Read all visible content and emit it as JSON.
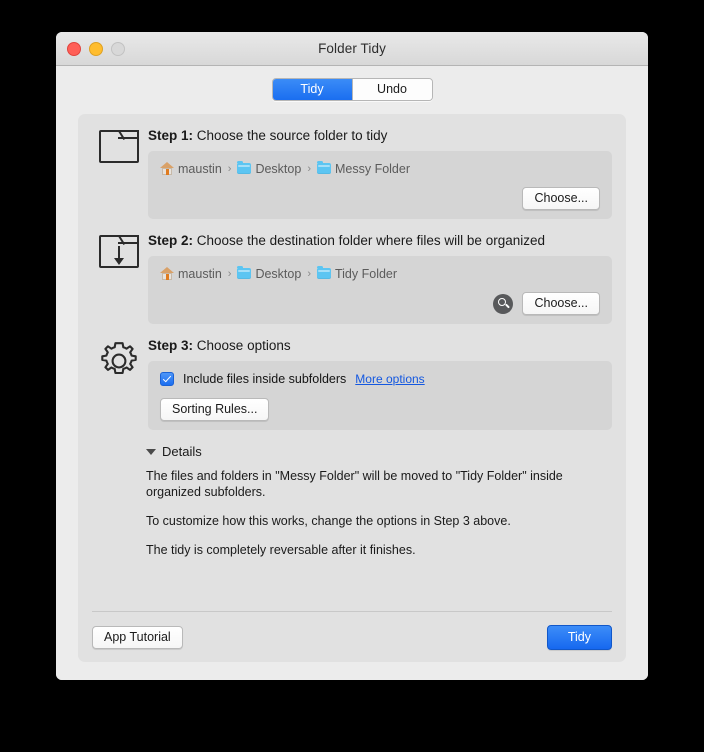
{
  "window": {
    "title": "Folder Tidy",
    "traffic_lights": [
      "close-red",
      "minimize-yellow",
      "zoom-disabled"
    ]
  },
  "tabs": [
    {
      "label": "Tidy",
      "active": true
    },
    {
      "label": "Undo",
      "active": false
    }
  ],
  "steps": [
    {
      "number": "Step 1:",
      "description": "Choose the source folder to tidy",
      "icon": "folder-outline-icon",
      "breadcrumb": [
        {
          "icon": "home-icon",
          "label": "maustin"
        },
        {
          "icon": "folder-icon",
          "label": "Desktop"
        },
        {
          "icon": "folder-icon",
          "label": "Messy Folder"
        }
      ],
      "separator": "›",
      "choose_label": "Choose...",
      "has_reveal": false
    },
    {
      "number": "Step 2:",
      "description": "Choose the destination folder where files will be organized",
      "icon": "folder-download-icon",
      "breadcrumb": [
        {
          "icon": "home-icon",
          "label": "maustin"
        },
        {
          "icon": "folder-icon",
          "label": "Desktop"
        },
        {
          "icon": "folder-icon",
          "label": "Tidy Folder"
        }
      ],
      "separator": "›",
      "choose_label": "Choose...",
      "has_reveal": true,
      "reveal_icon": "search-icon"
    },
    {
      "number": "Step 3:",
      "description": "Choose options",
      "icon": "gear-icon",
      "checkbox_label": "Include files inside subfolders",
      "checkbox_checked": true,
      "more_options_label": "More options",
      "sorting_rules_label": "Sorting Rules..."
    }
  ],
  "details": {
    "title": "Details",
    "expanded": true,
    "paragraphs": [
      "The files and folders in \"Messy Folder\" will be moved to \"Tidy Folder\" inside organized subfolders.",
      "To customize how this works, change the options in Step 3 above.",
      "The tidy is completely reversable after it finishes."
    ]
  },
  "footer": {
    "tutorial_label": "App Tutorial",
    "primary_label": "Tidy"
  },
  "colors": {
    "accent_blue": "#1668ef",
    "link_blue": "#1458e0",
    "folder_blue": "#5cc5f2",
    "window_bg": "#ececec",
    "panel_bg": "#e1e1e1",
    "subpanel_bg": "#d5d5d5"
  }
}
